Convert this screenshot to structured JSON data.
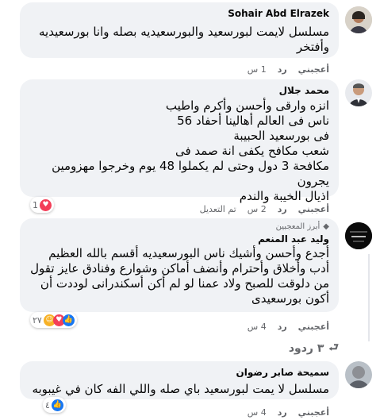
{
  "comments": [
    {
      "author": "Sohair Abd Elrazek",
      "text": "مسلسل لايمت لبورسعيد والبورسعيديه بصله وانا بورسعيديه وأفتخر",
      "actions": {
        "like": "أعجبني",
        "reply": "رد",
        "time": "1 س"
      }
    },
    {
      "author": "محمد جلال",
      "text": "انزه وارقى وأحسن وأكرم واطيب\nناس فى العالم أهالينا أحفاد 56\nفى بورسعيد الحبيبة\nشعب مكافح يكفى انة صمد فى\nمكافحة 3 دول وحتى لم يكملوا 48 يوم وخرجوا مهزومين يجرون\nاذيال الخيبة والندم",
      "actions": {
        "like": "أعجبني",
        "reply": "رد",
        "time": "2 س",
        "edited": "تم التعديل"
      },
      "reaction_count": "1"
    },
    {
      "badge": "أبرز المعجبين",
      "author": "وليد عبد المنعم",
      "text": "أجدع وأحسن وأشيك ناس البورسعيديه أقسم بالله العظيم أدب وأخلاق وأحترام وأنضف أماكن وشوارع وفنادق عايز تقول من دلوقت للصبح ولاد عمنا لو لم أكن أسكندرانى لوددت أن أكون بورسعيدى",
      "actions": {
        "like": "أعجبني",
        "reply": "رد",
        "time": "4 س"
      },
      "reaction_count": "٢٧",
      "replies": "٣ ردود"
    },
    {
      "author": "سميحة صابر رضوان",
      "text": "مسلسل لا يمت لبورسعيد باي صله واللي الفه كان في غيبوبه",
      "actions": {
        "like": "أعجبني",
        "reply": "رد",
        "time": "4 س"
      },
      "reaction_count": "٤"
    }
  ],
  "colors": {
    "bubble": "#f0f2f5",
    "like": "#1877f2",
    "love": "#f33e58",
    "care": "#f7b125",
    "meta": "#65676b"
  }
}
